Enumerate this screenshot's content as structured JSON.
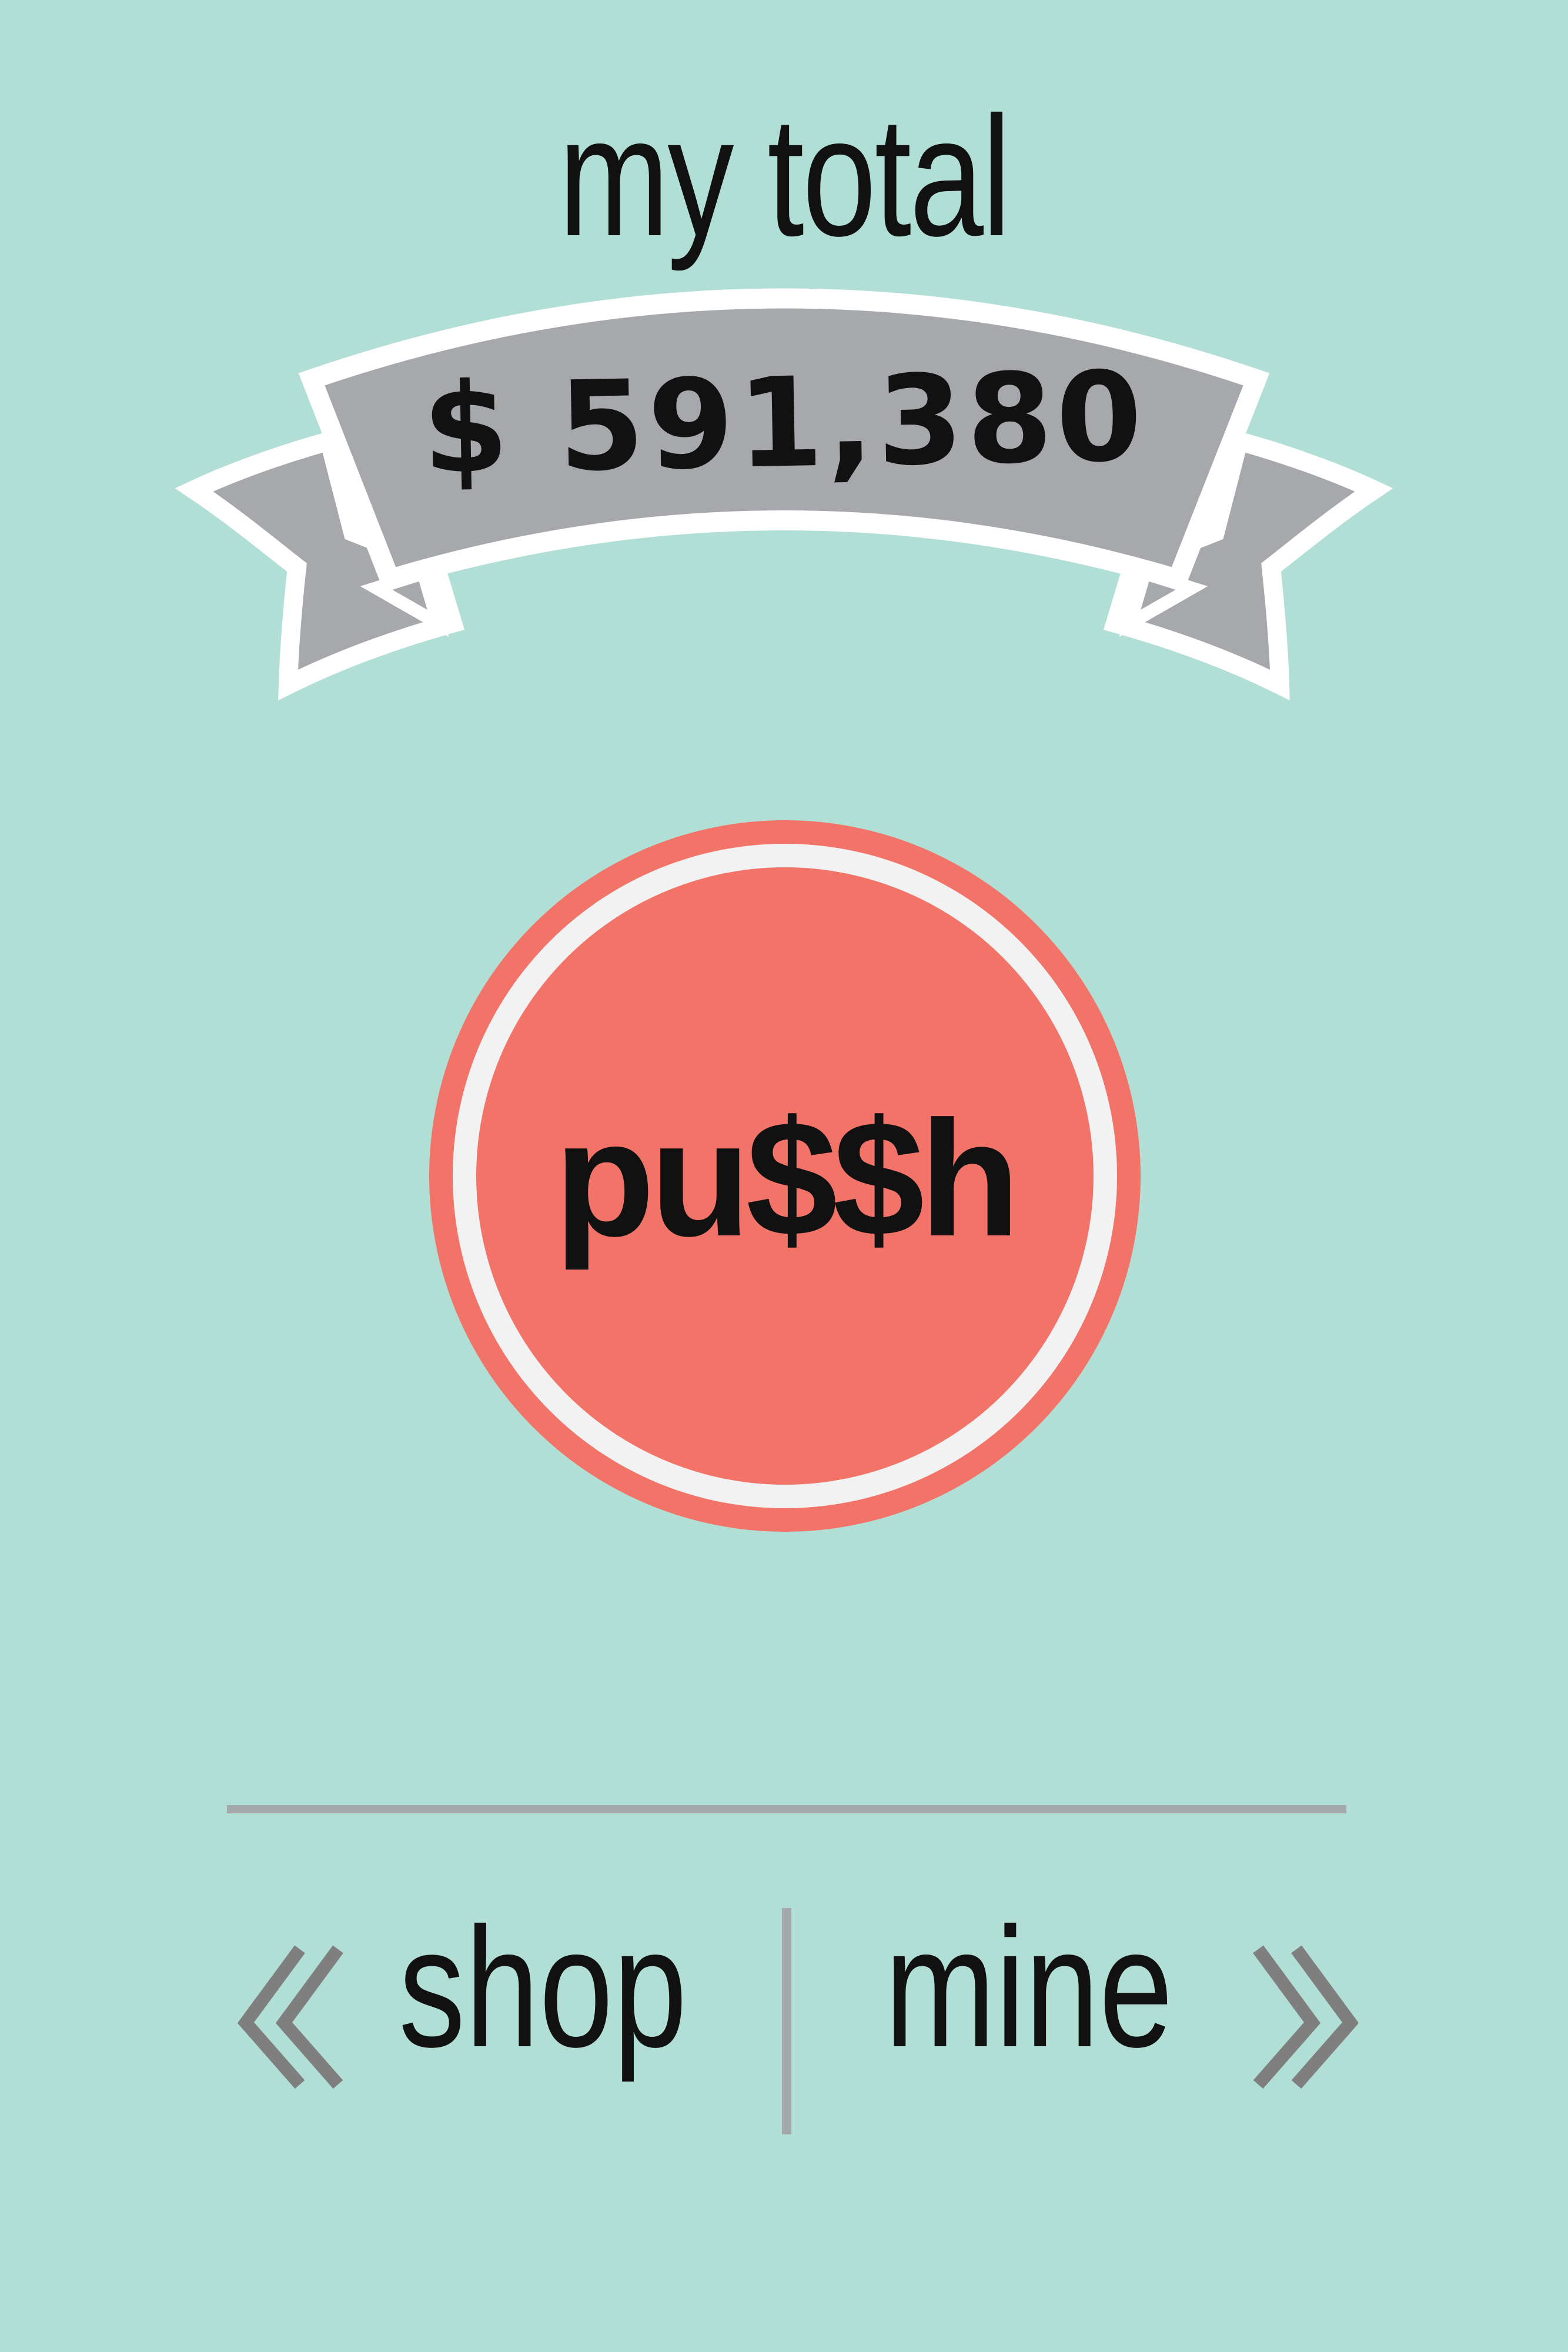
{
  "header": {
    "title": "my total"
  },
  "total": {
    "value": "$ 591,380"
  },
  "push_button": {
    "label": "pu$$h"
  },
  "nav": {
    "left_label": "shop",
    "right_label": "mine"
  },
  "colors": {
    "background": "#b1dfd6",
    "button": "#f27468",
    "ring": "#f2f2f3",
    "ribbon": "#a7a8ab",
    "divider": "#a5a8ab",
    "chevron": "#7f7f7f"
  },
  "icons": [
    "double-chevron-left-icon",
    "double-chevron-right-icon",
    "ribbon-banner"
  ]
}
